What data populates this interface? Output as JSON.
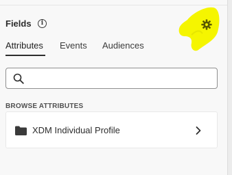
{
  "panel": {
    "title": "Fields",
    "info_icon": "info-icon",
    "settings_icon": "gear-icon",
    "highlight_color": "#f5f500"
  },
  "tabs": [
    {
      "label": "Attributes",
      "active": true
    },
    {
      "label": "Events",
      "active": false
    },
    {
      "label": "Audiences",
      "active": false
    }
  ],
  "search": {
    "value": "",
    "placeholder": "",
    "icon": "search-icon"
  },
  "browse": {
    "section_label": "BROWSE ATTRIBUTES",
    "items": [
      {
        "label": "XDM Individual Profile",
        "icon": "folder-icon",
        "trailing_icon": "chevron-right-icon"
      }
    ]
  }
}
